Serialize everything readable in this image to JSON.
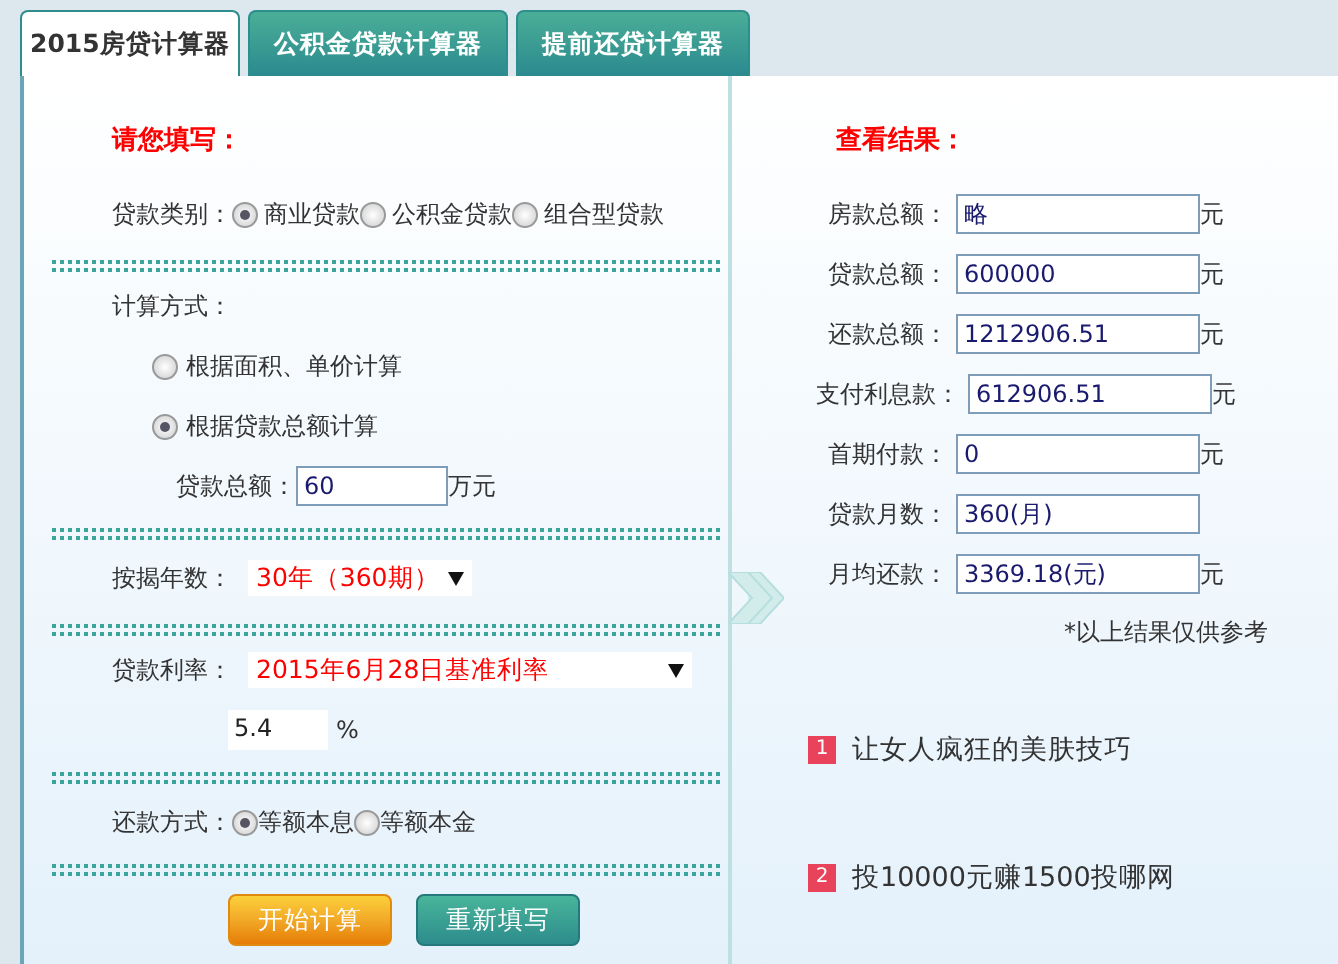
{
  "tabs": [
    {
      "label": "2015房贷计算器",
      "selected": true
    },
    {
      "label": "公积金贷款计算器",
      "selected": false
    },
    {
      "label": "提前还贷计算器",
      "selected": false
    }
  ],
  "form": {
    "heading": "请您填写：",
    "loan_type": {
      "label": "贷款类别：",
      "options": [
        {
          "label": "商业贷款",
          "selected": true
        },
        {
          "label": "公积金贷款",
          "selected": false
        },
        {
          "label": "组合型贷款",
          "selected": false
        }
      ]
    },
    "calc_method": {
      "label": "计算方式：",
      "options": [
        {
          "label": "根据面积、单价计算",
          "selected": false
        },
        {
          "label": "根据贷款总额计算",
          "selected": true
        }
      ]
    },
    "loan_amount": {
      "label": "贷款总额：",
      "value": "60",
      "unit": "万元"
    },
    "years": {
      "label": "按揭年数：",
      "value": "30年（360期）"
    },
    "rate": {
      "label": "贷款利率：",
      "value": "2015年6月28日基准利率",
      "rate_value": "5.4",
      "unit": "%"
    },
    "repayment": {
      "label": "还款方式：",
      "options": [
        {
          "label": "等额本息",
          "selected": true
        },
        {
          "label": "等额本金",
          "selected": false
        }
      ]
    },
    "buttons": [
      {
        "label": "开始计算",
        "kind": "primary"
      },
      {
        "label": "重新填写",
        "kind": "secondary"
      }
    ]
  },
  "results": {
    "heading": "查看结果：",
    "rows": [
      {
        "label": "房款总额：",
        "value": "略",
        "unit": "元"
      },
      {
        "label": "贷款总额：",
        "value": "600000",
        "unit": "元"
      },
      {
        "label": "还款总额：",
        "value": "1212906.51",
        "unit": "元"
      },
      {
        "label": "支付利息款：",
        "value": "612906.51",
        "unit": "元"
      },
      {
        "label": "首期付款：",
        "value": "0",
        "unit": "元"
      },
      {
        "label": "贷款月数：",
        "value": "360(月)"
      },
      {
        "label": "月均还款：",
        "value": "3369.18(元)",
        "unit": "元"
      }
    ],
    "note": "*以上结果仅供参考"
  },
  "links": [
    {
      "number": "1",
      "text": "让女人疯狂的美肤技巧"
    },
    {
      "number": "2",
      "text": "投10000元赚1500投哪网"
    }
  ]
}
